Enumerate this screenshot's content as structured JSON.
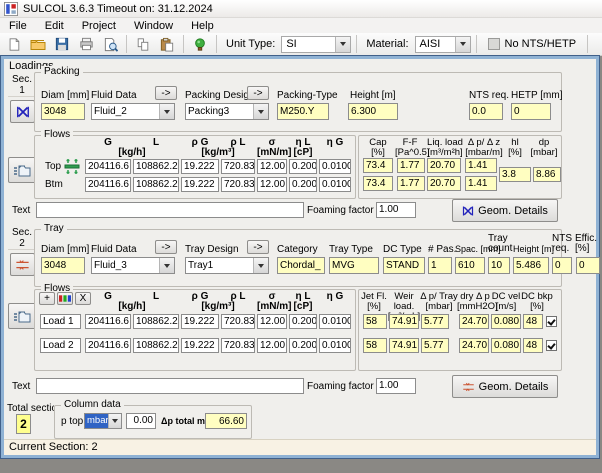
{
  "window": {
    "title": "SULCOL 3.6.3 Timeout on: 31.12.2024"
  },
  "menu": {
    "items": [
      "File",
      "Edit",
      "Project",
      "Window",
      "Help"
    ]
  },
  "toolbar": {
    "unit_type_label": "Unit Type:",
    "unit_type_value": "SI",
    "material_label": "Material:",
    "material_value": "AISI",
    "nts_label": "No NTS/HETP"
  },
  "panel": {
    "tab_label": "Loadings",
    "status": "Current Section: 2"
  },
  "packing": {
    "sec_label": "Sec.",
    "sec_number": "1",
    "group_title": "Packing",
    "diam_label": "Diam [mm]",
    "diam_value": "3048",
    "fluid_label": "Fluid Data",
    "fluid_value": "Fluid_2",
    "arrow1": "->",
    "design_label": "Packing Design",
    "arrow2": "->",
    "design_value": "Packing3",
    "type_label": "Packing-Type",
    "type_value": "M250.Y",
    "height_label": "Height  [m]",
    "height_value": "6.300",
    "nts_label": "NTS req.",
    "nts_value": "0.0",
    "hetp_label": "HETP [mm]",
    "hetp_value": "0"
  },
  "packing_flows": {
    "group_title": "Flows",
    "headers": [
      "G",
      "L",
      "ρ G",
      "ρ L",
      "σ",
      "η L",
      "η G"
    ],
    "units": {
      "kg_h": "[kg/h]",
      "kg_m3": "[kg/m³]",
      "mn_m": "[mN/m]",
      "cp": "[cP]"
    },
    "rows": [
      {
        "label": "Top",
        "values": [
          "204116.6",
          "108862.2",
          "19.222",
          "720.83",
          "12.00",
          "0.200",
          "0.0100"
        ]
      },
      {
        "label": "Btm",
        "values": [
          "204116.6",
          "108862.2",
          "19.222",
          "720.83",
          "12.00",
          "0.200",
          "0.0100"
        ]
      }
    ],
    "results": {
      "headers": [
        "Cap\n[%]",
        "F-F\n[Pa^0.5]",
        "Liq. load\n[m³/m²h]",
        "Δ p/ Δ z\n[mbar/m]",
        "hl\n[%]",
        "dp\n[mbar]"
      ],
      "rows": [
        [
          "73.4",
          "1.77",
          "20.70",
          "1.41"
        ],
        [
          "73.4",
          "1.77",
          "20.70",
          "1.41"
        ]
      ],
      "hl": "3.8",
      "dp": "8.86"
    }
  },
  "packing_text": {
    "label": "Text",
    "value": "",
    "foaming_label": "Foaming factor",
    "foaming_value": "1.00",
    "geom_label": "Geom. Details"
  },
  "tray": {
    "sec_label": "Sec.",
    "sec_number": "2",
    "group_title": "Tray",
    "diam_label": "Diam [mm]",
    "diam_value": "3048",
    "fluid_label": "Fluid Data",
    "fluid_value": "Fluid_3",
    "arrow1": "->",
    "design_label": "Tray Design",
    "arrow2": "->",
    "design_value": "Tray1",
    "category_label": "Category",
    "category_value": "Chordal_",
    "type_label": "Tray Type",
    "type_value": "MVG",
    "dc_label": "DC Type",
    "dc_value": "STAND",
    "pas_label": "# Pas.",
    "pas_value": "1",
    "spac_label": "Spac. [mm]",
    "spac_value": "610",
    "count_label": "Tray\ncount",
    "count_value": "10",
    "height_label": "Height [m]",
    "height_value": "5.486",
    "nts_label": "NTS\nreq.",
    "nts_value": "0",
    "effic_label": "Effic.\n[%]",
    "effic_value": "0"
  },
  "tray_flows": {
    "group_title": "Flows",
    "add_label": "+",
    "delete_label": "X",
    "headers": [
      "G",
      "L",
      "ρ G",
      "ρ L",
      "σ",
      "η L",
      "η G"
    ],
    "units": {
      "kg_h": "[kg/h]",
      "kg_m3": "[kg/m³]",
      "mn_m": "[mN/m]",
      "cp": "[cP]"
    },
    "rows": [
      {
        "label": "Load 1",
        "values": [
          "204116.6",
          "108862.2",
          "19.222",
          "720.83",
          "12.00",
          "0.200",
          "0.0100"
        ]
      },
      {
        "label": "Load 2",
        "values": [
          "204116.6",
          "108862.2",
          "19.222",
          "720.83",
          "12.00",
          "0.200",
          "0.0100"
        ]
      }
    ],
    "results": {
      "headers": [
        "Jet Fl.\n[%]",
        "Weir load.\n[m³/mh]",
        "Δ p/ Tray\n[mbar]",
        "dry Δ p\n[mmH2O]",
        "DC vel\n[m/s]",
        "DC bkp\n[%]"
      ],
      "rows": [
        [
          "58",
          "74.91",
          "5.77",
          "24.70",
          "0.080",
          "48"
        ],
        [
          "58",
          "74.91",
          "5.77",
          "24.70",
          "0.080",
          "48"
        ]
      ],
      "dc_bkp_checked": [
        true,
        true
      ]
    }
  },
  "tray_text": {
    "label": "Text",
    "value": "",
    "foaming_label": "Foaming factor",
    "foaming_value": "1.00",
    "geom_label": "Geom. Details"
  },
  "totals": {
    "total_label": "Total sectio",
    "total_value": "2",
    "group_title": "Column data",
    "p_top_label": "p top",
    "p_top_unit": "mbar",
    "p_top_value": "0.00",
    "dp_total_label": "Δp total mbar",
    "dp_total_value": "66.60"
  },
  "colors": {
    "panel_border": "#8fb2d4",
    "field_yellow": "#fffec1",
    "selection_blue": "#2f63c4",
    "status_bg": "#f8f2e4"
  }
}
